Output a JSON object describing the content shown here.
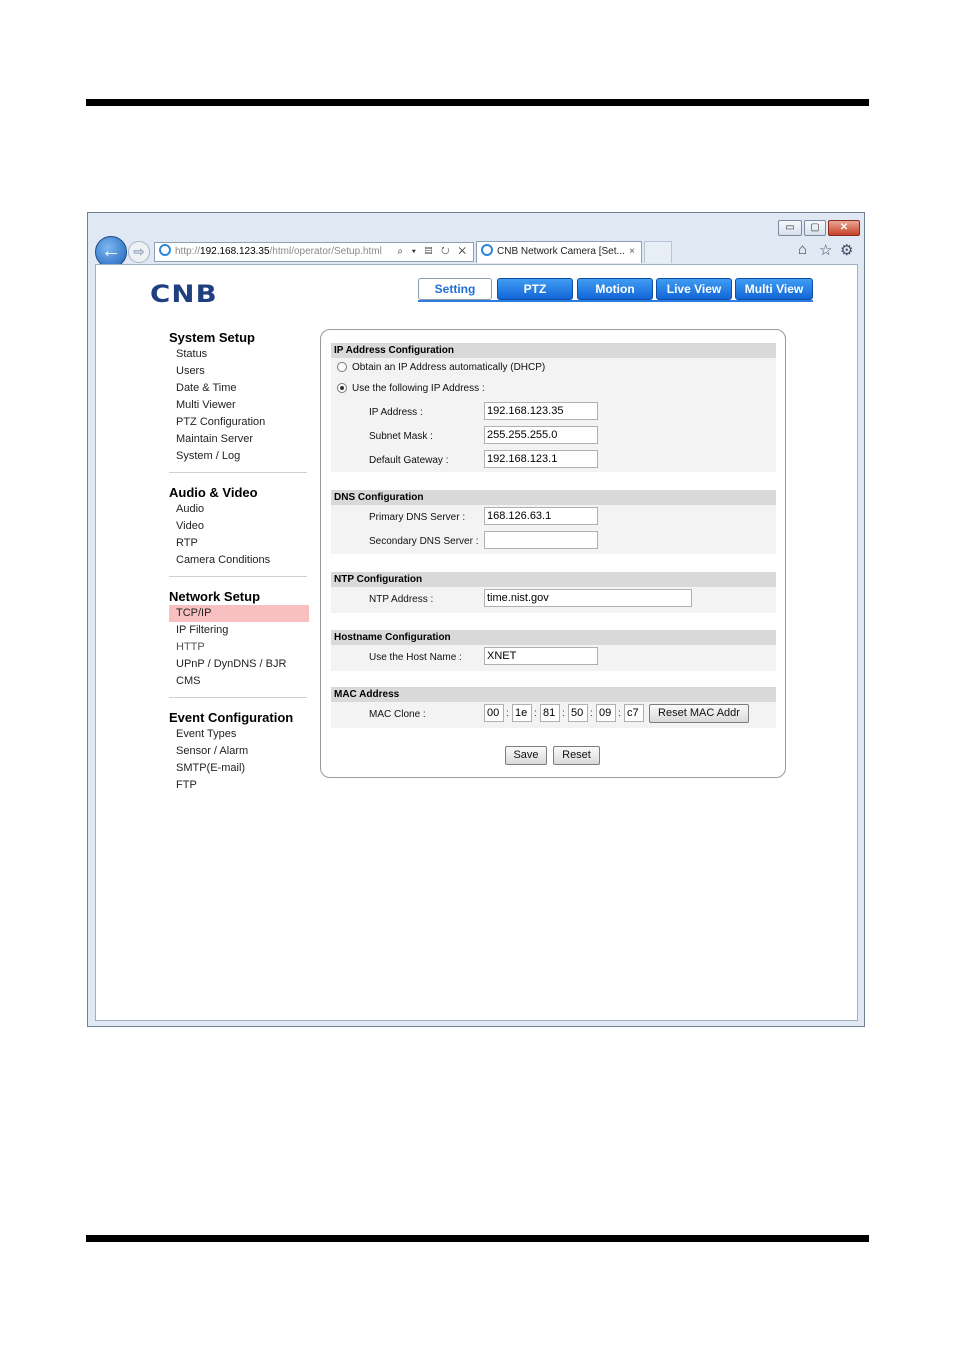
{
  "browser": {
    "window_controls": {
      "minimize": "▭",
      "maximize": "▢",
      "close": "✕"
    },
    "back_icon": "←",
    "forward_icon": "⇨",
    "address": {
      "prefix": "http://",
      "host": "192.168.123.35",
      "path": "/html/operator/Setup.html"
    },
    "address_tools": "⌕ ▾ ▤ ↻ ✕",
    "tab_title": "CNB Network Camera [Set...",
    "tab_close": "×",
    "toolbar_icons": {
      "home": "⌂",
      "favorites": "☆",
      "tools": "⚙"
    }
  },
  "app": {
    "logo": "CNB",
    "nav": [
      "Setting",
      "PTZ",
      "Motion",
      "Live View",
      "Multi View"
    ]
  },
  "sidebar": {
    "sections": [
      {
        "title": "System Setup",
        "items": [
          "Status",
          "Users",
          "Date & Time",
          "Multi Viewer",
          "PTZ Configuration",
          "Maintain Server",
          "System / Log"
        ]
      },
      {
        "title": "Audio & Video",
        "items": [
          "Audio",
          "Video",
          "RTP",
          "Camera Conditions"
        ]
      },
      {
        "title": "Network Setup",
        "items": [
          "TCP/IP",
          "IP Filtering",
          "HTTP",
          "UPnP / DynDNS / BJR",
          "CMS"
        ]
      },
      {
        "title": "Event Configuration",
        "items": [
          "Event Types",
          "Sensor / Alarm",
          "SMTP(E-mail)",
          "FTP"
        ]
      }
    ],
    "active_item": "TCP/IP"
  },
  "form": {
    "ip": {
      "heading": "IP Address Configuration",
      "dhcp_label": "Obtain an IP Address automatically (DHCP)",
      "static_label": "Use the following IP Address :",
      "selected": "static",
      "ip_label": "IP Address :",
      "ip_value": "192.168.123.35",
      "mask_label": "Subnet Mask :",
      "mask_value": "255.255.255.0",
      "gw_label": "Default Gateway :",
      "gw_value": "192.168.123.1"
    },
    "dns": {
      "heading": "DNS Configuration",
      "primary_label": "Primary DNS Server :",
      "primary_value": "168.126.63.1",
      "secondary_label": "Secondary DNS Server :",
      "secondary_value": ""
    },
    "ntp": {
      "heading": "NTP Configuration",
      "label": "NTP Address :",
      "value": "time.nist.gov"
    },
    "hostname": {
      "heading": "Hostname Configuration",
      "label": "Use the Host Name :",
      "value": "XNET"
    },
    "mac": {
      "heading": "MAC Address",
      "label": "MAC Clone :",
      "octets": [
        "00",
        "1e",
        "81",
        "50",
        "09",
        "c7"
      ],
      "separator": ":",
      "reset_label": "Reset MAC Addr"
    },
    "save_label": "Save",
    "reset_label": "Reset"
  }
}
